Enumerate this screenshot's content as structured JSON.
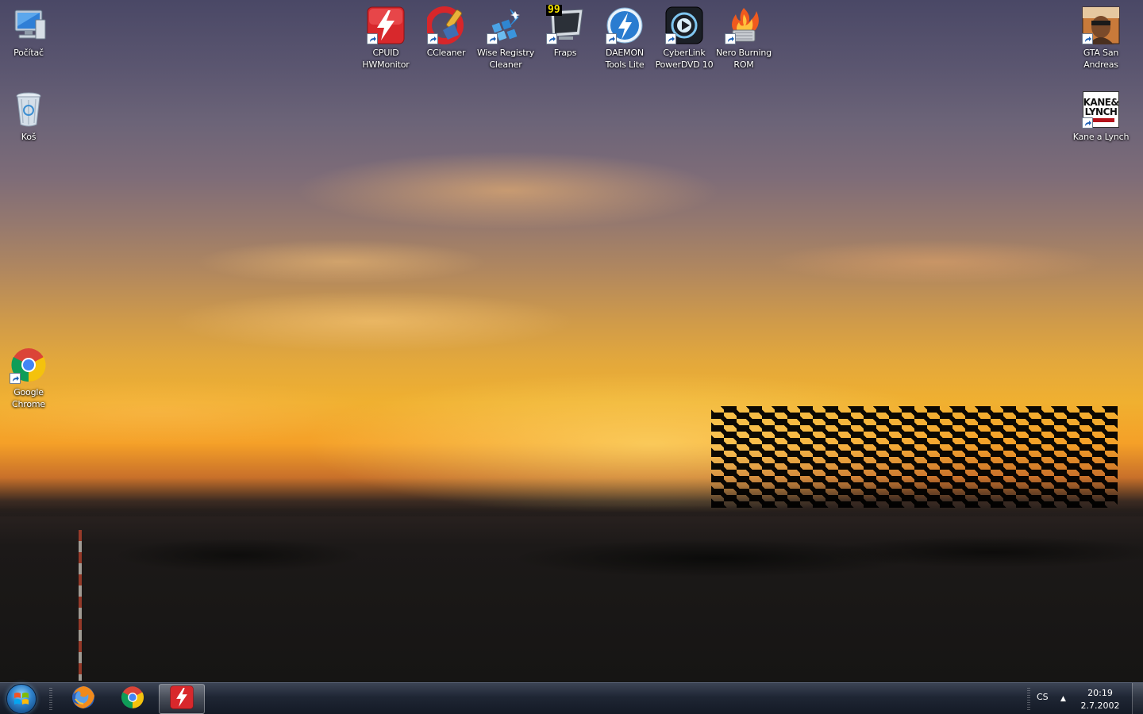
{
  "desktop": {
    "icons": [
      {
        "id": "computer",
        "label": "Počítač",
        "icon": "computer-icon"
      },
      {
        "id": "recycle-bin",
        "label": "Koš",
        "icon": "recycle-bin-icon"
      },
      {
        "id": "chrome",
        "label": "Google\nChrome",
        "icon": "chrome-icon"
      },
      {
        "id": "cpuid",
        "label": "CPUID\nHWMonitor",
        "icon": "hwmonitor-icon"
      },
      {
        "id": "ccleaner",
        "label": "CCleaner",
        "icon": "ccleaner-icon"
      },
      {
        "id": "wise",
        "label": "Wise Registry\nCleaner",
        "icon": "wise-registry-icon"
      },
      {
        "id": "fraps",
        "label": "Fraps",
        "icon": "fraps-icon",
        "badge": "99"
      },
      {
        "id": "daemon",
        "label": "DAEMON\nTools Lite",
        "icon": "daemon-tools-icon"
      },
      {
        "id": "powerdvd",
        "label": "CyberLink\nPowerDVD 10",
        "icon": "powerdvd-icon"
      },
      {
        "id": "nero",
        "label": "Nero Burning\nROM",
        "icon": "nero-icon"
      },
      {
        "id": "gta",
        "label": "GTA San\nAndreas",
        "icon": "gta-icon"
      },
      {
        "id": "kane",
        "label": "Kane a Lynch",
        "icon": "kane-lynch-icon",
        "art_text": "KANE&\nLYNCH"
      }
    ]
  },
  "taskbar": {
    "pinned": [
      {
        "name": "Firefox",
        "icon": "firefox-icon"
      },
      {
        "name": "Google Chrome",
        "icon": "chrome-icon"
      },
      {
        "name": "CPUID HWMonitor",
        "icon": "hwmonitor-icon",
        "active": true
      }
    ],
    "tray": {
      "language": "CS",
      "time": "20:19",
      "date": "2.7.2002"
    }
  },
  "colors": {
    "taskbar": "#1f2634",
    "accent": "#2d7fc7",
    "hwmonitor_red": "#d8282c"
  }
}
